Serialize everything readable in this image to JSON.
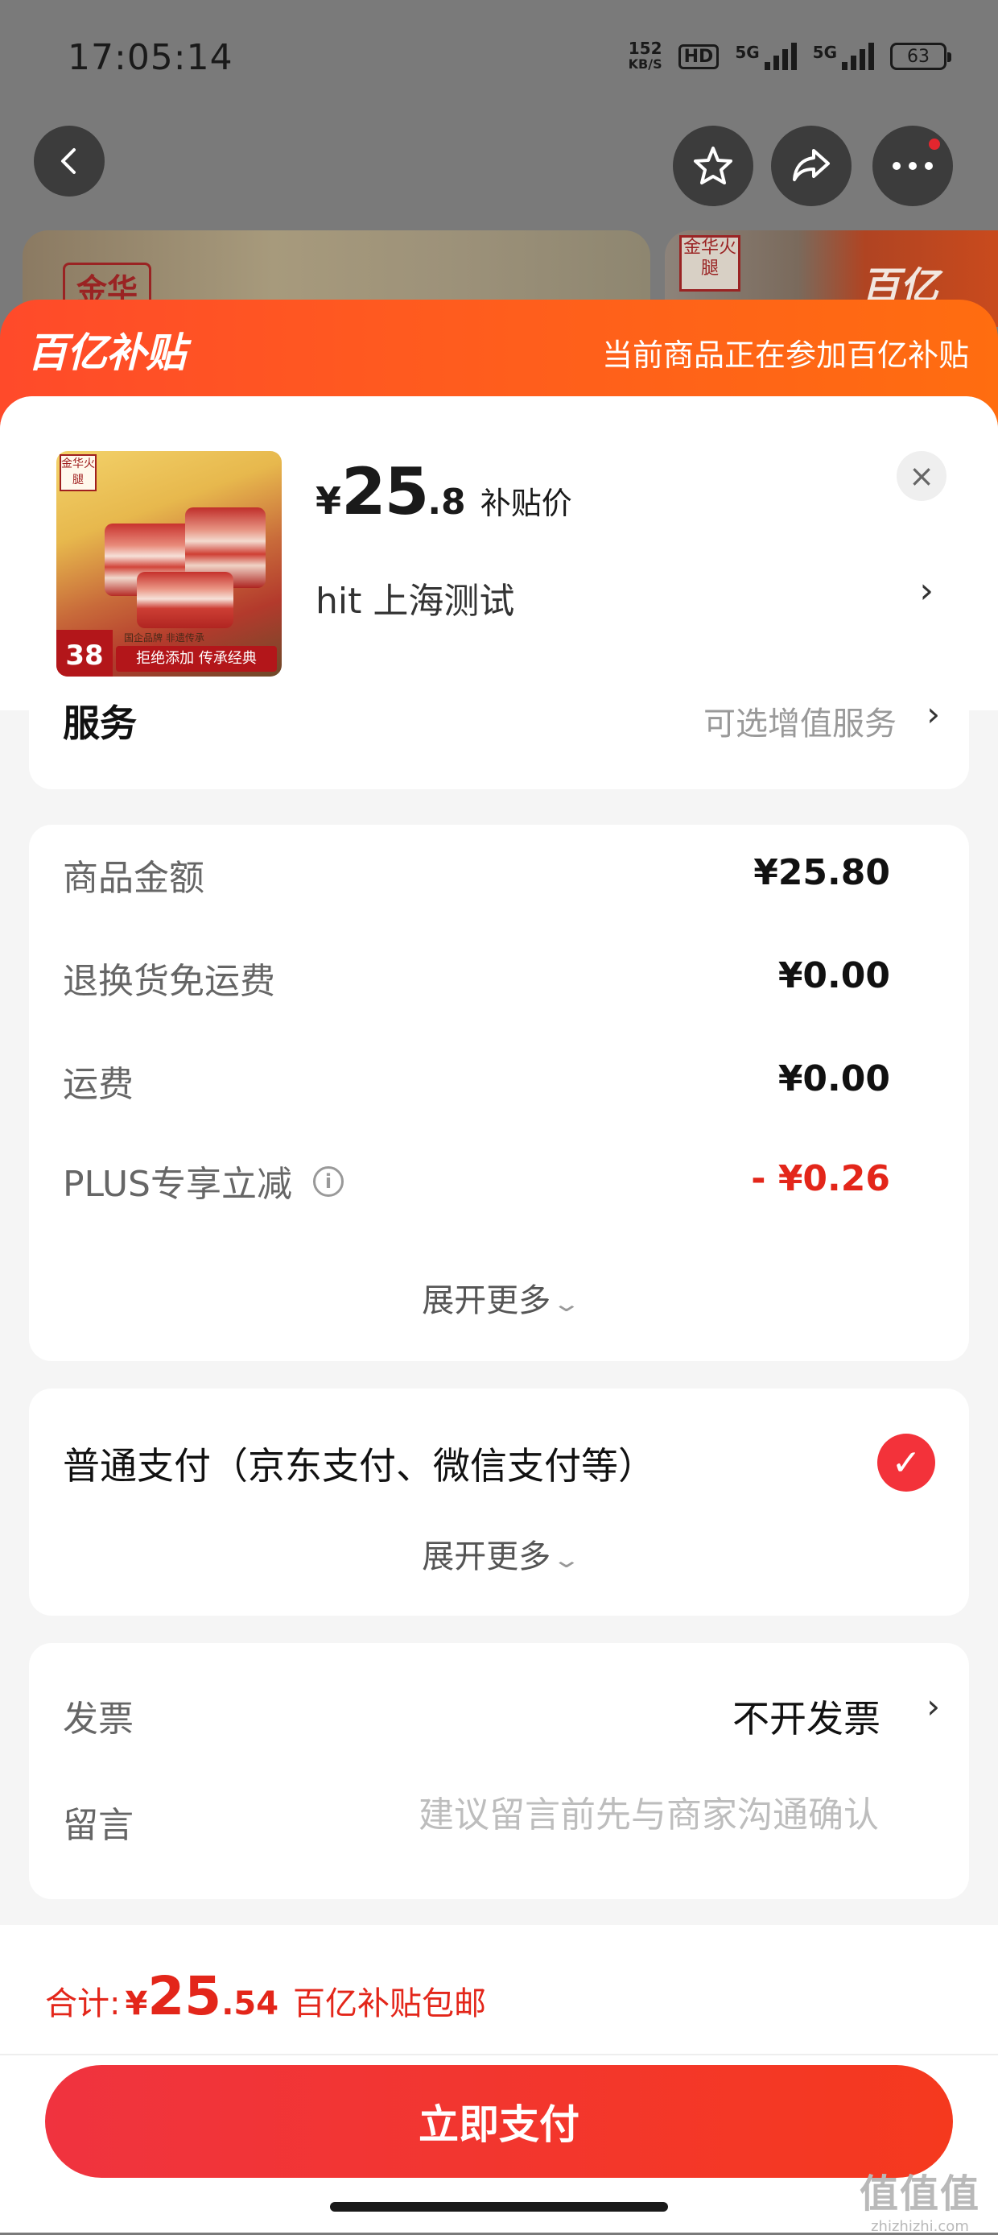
{
  "status_bar": {
    "time": "17:05:14",
    "net_speed_value": "152",
    "net_speed_unit": "KB/S",
    "hd_label": "HD",
    "signal1_label": "5G",
    "signal2_label": "5G",
    "battery": "63"
  },
  "background": {
    "brand_left": "金华",
    "brand_right": "金华火腿",
    "logo_right": "百亿"
  },
  "sheet": {
    "logo": "百亿补贴",
    "notice": "当前商品正在参加百亿补贴",
    "accent_color": "#ff5a1f"
  },
  "product": {
    "thumb_brand": "金华火腿",
    "thumb_price_tag": "38",
    "thumb_banner": "拒绝添加 传承经典",
    "thumb_sub": "国企品牌 非遗传承",
    "price_symbol": "¥",
    "price_int": "25",
    "price_dec": ".8",
    "price_label": "补贴价",
    "address": "hit  上海测试",
    "close_icon": "×",
    "address_chevron": "›"
  },
  "service": {
    "title": "服务",
    "value": "可选增值服务",
    "chevron": "›"
  },
  "amounts": {
    "rows": [
      {
        "label": "商品金额",
        "value": "¥25.80"
      },
      {
        "label": "退换货免运费",
        "value": "¥0.00"
      },
      {
        "label": "运费",
        "value": "¥0.00"
      },
      {
        "label": "PLUS专享立减",
        "value": "- ¥0.26"
      }
    ],
    "info_icon": "i",
    "expand": "展开更多"
  },
  "payment": {
    "method": "普通支付（京东支付、微信支付等）",
    "check_icon": "✓",
    "expand": "展开更多"
  },
  "invoice": {
    "label": "发票",
    "value": "不开发票",
    "chevron": "›",
    "note_label": "留言",
    "note_placeholder": "建议留言前先与商家沟通确认"
  },
  "bottom": {
    "total_label": "合计:",
    "total_symbol": "¥",
    "total_int": "25",
    "total_dec": ".54",
    "total_note": "百亿补贴包邮",
    "pay_button": "立即支付",
    "watermark_big": "值值值",
    "watermark_small": "zhizhizhi.com"
  },
  "colors": {
    "price_red": "#e3261a",
    "button_red": "#f0333f"
  }
}
